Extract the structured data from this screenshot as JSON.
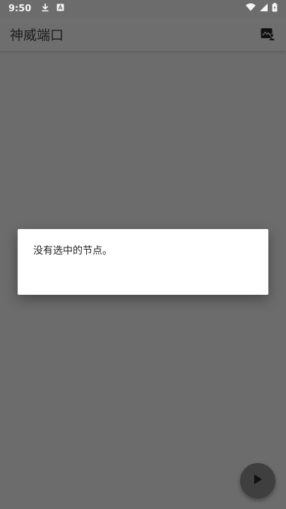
{
  "status_bar": {
    "time": "9:50",
    "left_icons": [
      "download-icon",
      "app-notification-icon"
    ],
    "right_icons": [
      "wifi-icon",
      "cellular-signal-icon",
      "battery-icon"
    ]
  },
  "app_bar": {
    "title": "神威端口",
    "action_icon": "gallery-person-icon"
  },
  "dialog": {
    "message": "没有选中的节点。"
  },
  "fab": {
    "icon": "play-icon"
  },
  "colors": {
    "scrim_background": "#6c6c6c",
    "dialog_background": "#ffffff",
    "fab_background": "#3f3f3f"
  }
}
